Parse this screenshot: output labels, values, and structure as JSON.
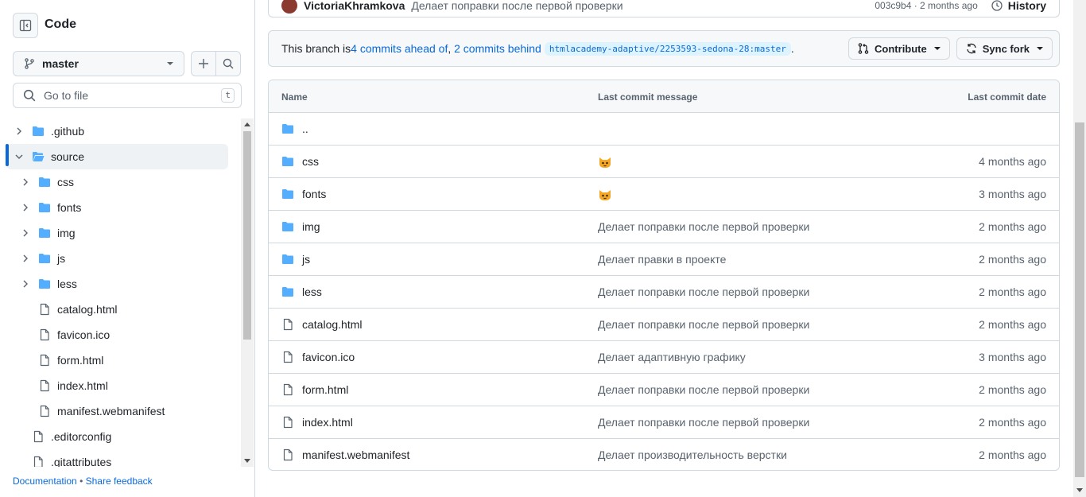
{
  "sidebar": {
    "title": "Code",
    "branch": "master",
    "search_placeholder": "Go to file",
    "search_shortcut": "t",
    "tree": [
      {
        "label": ".github",
        "type": "folder",
        "expanded": false,
        "depth": 0
      },
      {
        "label": "source",
        "type": "folder-open",
        "expanded": true,
        "depth": 0,
        "selected": true
      },
      {
        "label": "css",
        "type": "folder",
        "expanded": false,
        "depth": 1
      },
      {
        "label": "fonts",
        "type": "folder",
        "expanded": false,
        "depth": 1
      },
      {
        "label": "img",
        "type": "folder",
        "expanded": false,
        "depth": 1
      },
      {
        "label": "js",
        "type": "folder",
        "expanded": false,
        "depth": 1
      },
      {
        "label": "less",
        "type": "folder",
        "expanded": false,
        "depth": 1
      },
      {
        "label": "catalog.html",
        "type": "file",
        "depth": 1
      },
      {
        "label": "favicon.ico",
        "type": "file",
        "depth": 1
      },
      {
        "label": "form.html",
        "type": "file",
        "depth": 1
      },
      {
        "label": "index.html",
        "type": "file",
        "depth": 1
      },
      {
        "label": "manifest.webmanifest",
        "type": "file",
        "depth": 1
      },
      {
        "label": ".editorconfig",
        "type": "file",
        "depth": 0
      },
      {
        "label": ".gitattributes",
        "type": "file",
        "depth": 0
      }
    ],
    "footer": {
      "documentation": "Documentation",
      "separator": "•",
      "feedback": "Share feedback"
    }
  },
  "commit_strip": {
    "author": "VictoriaKhramkova",
    "message": "Делает поправки после первой проверки",
    "meta": "003c9b4 · 2 months ago",
    "history_label": "History"
  },
  "branch_banner": {
    "prefix": "This branch is ",
    "ahead": "4 commits ahead of",
    "comma": ",",
    "behind": "2 commits behind",
    "upstream": "htmlacademy-adaptive/2253593-sedona-28:master",
    "suffix": ".",
    "contribute_label": "Contribute",
    "sync_label": "Sync fork"
  },
  "table": {
    "headers": {
      "name": "Name",
      "message": "Last commit message",
      "date": "Last commit date"
    },
    "rows": [
      {
        "name": "..",
        "type": "folder",
        "message": "",
        "date": ""
      },
      {
        "name": "css",
        "type": "folder",
        "message": "",
        "emoji": "cat-face-icon",
        "date": "4 months ago"
      },
      {
        "name": "fonts",
        "type": "folder",
        "message": "",
        "emoji": "cat-face-icon",
        "date": "3 months ago"
      },
      {
        "name": "img",
        "type": "folder",
        "message": "Делает поправки после первой проверки",
        "date": "2 months ago"
      },
      {
        "name": "js",
        "type": "folder",
        "message": "Делает правки в проекте",
        "date": "2 months ago"
      },
      {
        "name": "less",
        "type": "folder",
        "message": "Делает поправки после первой проверки",
        "date": "2 months ago"
      },
      {
        "name": "catalog.html",
        "type": "file",
        "message": "Делает поправки после первой проверки",
        "date": "2 months ago"
      },
      {
        "name": "favicon.ico",
        "type": "file",
        "message": "Делает адаптивную графику",
        "date": "3 months ago"
      },
      {
        "name": "form.html",
        "type": "file",
        "message": "Делает поправки после первой проверки",
        "date": "2 months ago"
      },
      {
        "name": "index.html",
        "type": "file",
        "message": "Делает поправки после первой проверки",
        "date": "2 months ago"
      },
      {
        "name": "manifest.webmanifest",
        "type": "file",
        "message": "Делает производительность верстки",
        "date": "2 months ago"
      }
    ]
  },
  "colors": {
    "accent": "#0969da",
    "folder": "#54aeff",
    "border": "#d1d9e0",
    "muted": "#59636e"
  }
}
